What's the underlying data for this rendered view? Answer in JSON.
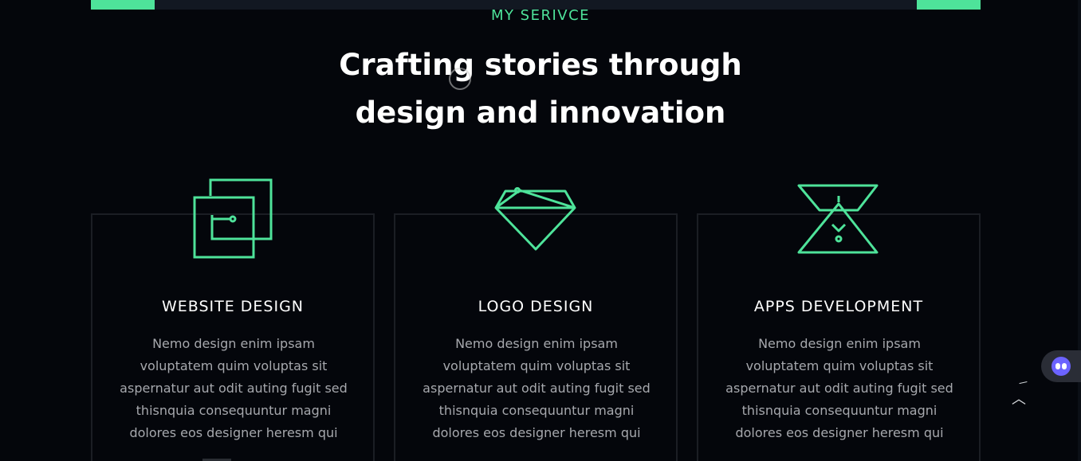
{
  "section": {
    "eyebrow": "MY SERIVCE",
    "title_line1": "Crafting stories through",
    "title_line2": "design and innovation"
  },
  "services": [
    {
      "title": "WEBSITE DESIGN",
      "icon": "layered-squares-icon",
      "lines": [
        "Nemo design enim ipsam",
        "voluptatem quim voluptas sit",
        "aspernatur aut odit auting fugit sed",
        "thisnquia consequuntur magni",
        "dolores eos designer heresm qui"
      ]
    },
    {
      "title": "LOGO DESIGN",
      "icon": "diamond-icon",
      "lines": [
        "Nemo design enim ipsam",
        "voluptatem quim voluptas sit",
        "aspernatur aut odit auting fugit sed",
        "thisnquia consequuntur magni",
        "dolores eos designer heresm qui"
      ]
    },
    {
      "title": "APPS DEVELOPMENT",
      "icon": "hourglass-triangle-icon",
      "lines": [
        "Nemo design enim ipsam",
        "voluptatem quim voluptas sit",
        "aspernatur aut odit auting fugit sed",
        "thisnquia consequuntur magni",
        "dolores eos designer heresm qui"
      ]
    }
  ],
  "widgets": {
    "chat_icon": "chat-assistant-icon",
    "scroll_top_glyph": "︿"
  },
  "colors": {
    "accent": "#4ee39a",
    "background": "#04060b",
    "card_border": "#1b1e24",
    "body_text": "#a6a8ad"
  }
}
